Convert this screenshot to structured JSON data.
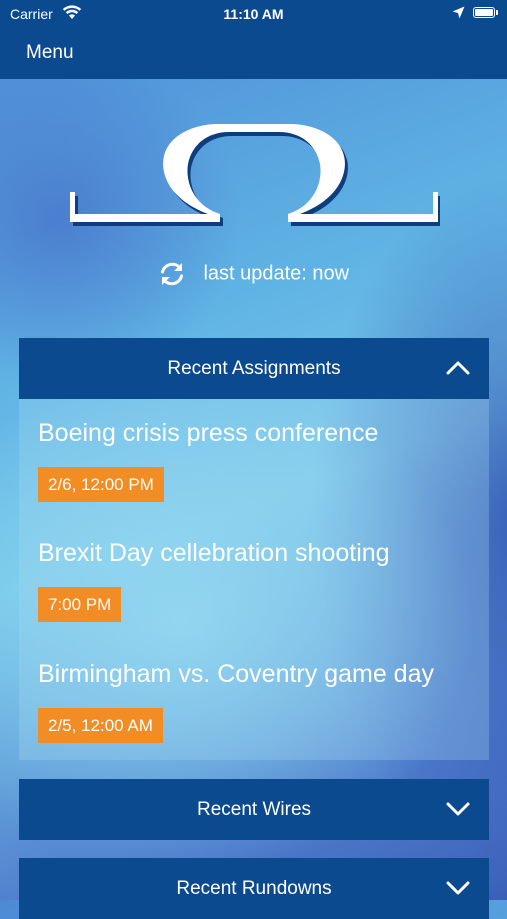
{
  "status_bar": {
    "carrier": "Carrier",
    "time": "11:10 AM",
    "icons": [
      "wifi-icon",
      "location-arrow-icon",
      "battery-icon"
    ]
  },
  "nav": {
    "menu_label": "Menu"
  },
  "logo": {
    "icon": "omega-logo"
  },
  "update": {
    "icon": "refresh-icon",
    "text": "last update: now"
  },
  "sections": [
    {
      "title": "Recent Assignments",
      "expanded": true,
      "icon": "chevron-up-icon",
      "items": [
        {
          "title": "Boeing crisis press conference",
          "time": "2/6, 12:00 PM"
        },
        {
          "title": "Brexit Day cellebration shooting",
          "time": "7:00 PM"
        },
        {
          "title": "Birmingham vs. Coventry game day",
          "time": "2/5, 12:00 AM"
        }
      ]
    },
    {
      "title": "Recent Wires",
      "expanded": false,
      "icon": "chevron-down-icon"
    },
    {
      "title": "Recent Rundowns",
      "expanded": false,
      "icon": "chevron-down-icon"
    }
  ],
  "colors": {
    "bar": "#0b4a8f",
    "badge": "#f28c25",
    "text": "#ffffff"
  }
}
